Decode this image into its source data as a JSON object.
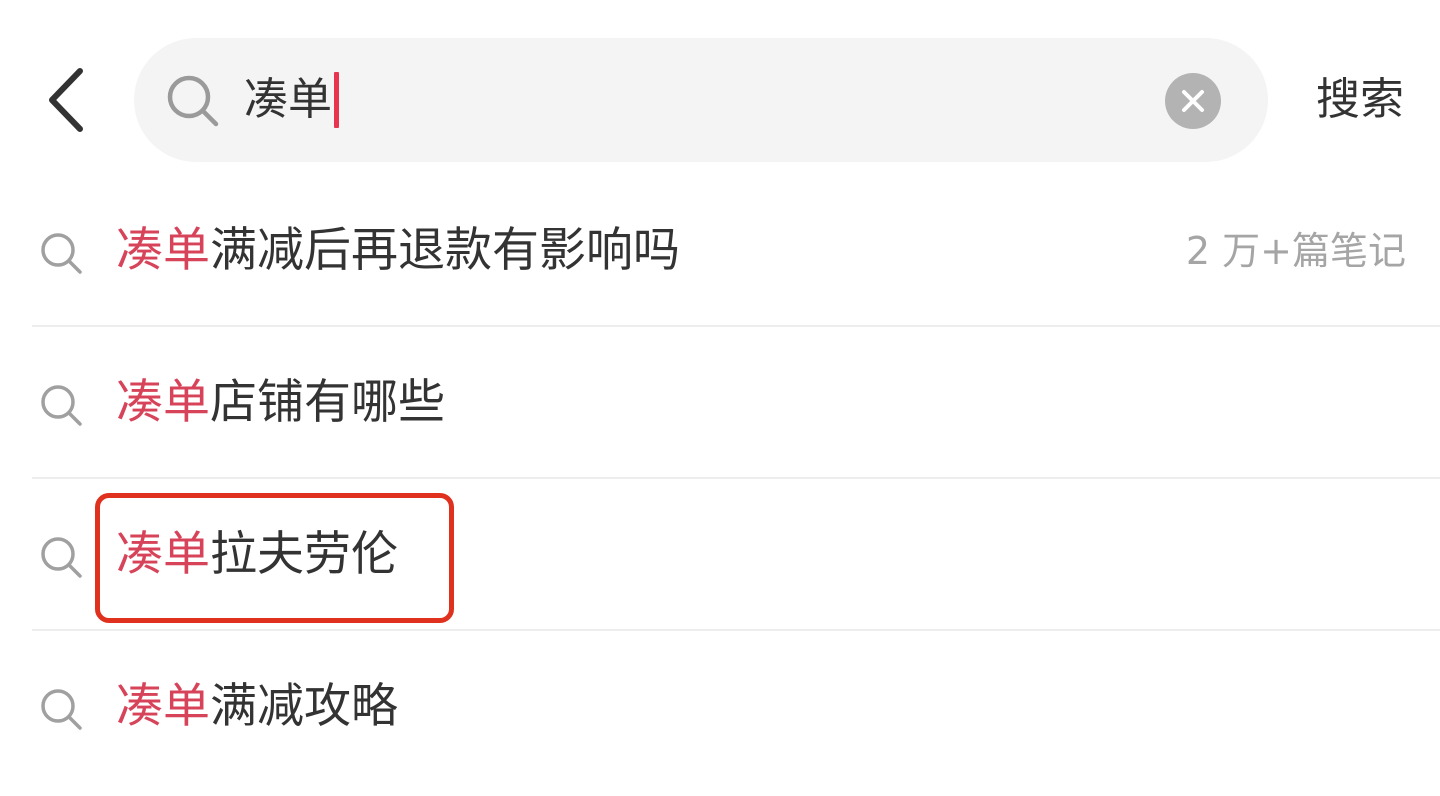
{
  "header": {
    "back_icon": "chevron-left-icon",
    "search": {
      "value": "凑单",
      "search_icon": "search-icon",
      "clear_icon": "clear-icon"
    },
    "submit_label": "搜索"
  },
  "suggestions": [
    {
      "highlight": "凑单",
      "rest": "满减后再退款有影响吗",
      "meta": "2 万+篇笔记",
      "boxed": false
    },
    {
      "highlight": "凑单",
      "rest": "店铺有哪些",
      "meta": "",
      "boxed": false
    },
    {
      "highlight": "凑单",
      "rest": "拉夫劳伦",
      "meta": "",
      "boxed": true
    },
    {
      "highlight": "凑单",
      "rest": "满减攻略",
      "meta": "",
      "boxed": false
    }
  ],
  "colors": {
    "accent": "#d7445a",
    "caret": "#e8344e",
    "annotation": "#e0301e",
    "search_bg": "#f4f4f4"
  }
}
